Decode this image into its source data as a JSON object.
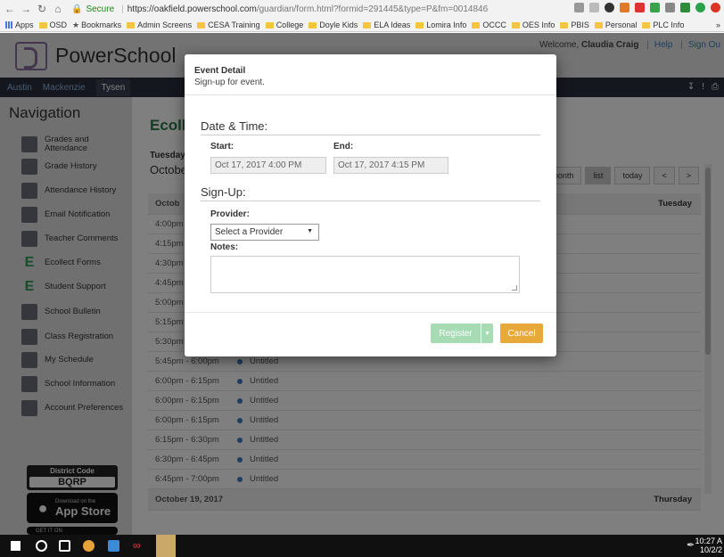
{
  "browser": {
    "secure_label": "Secure",
    "url_host": "https://oakfield.powerschool.com",
    "url_path": "/guardian/form.html?formid=291445&type=P&fm=0014846",
    "bookmarks": [
      "Apps",
      "OSD",
      "Bookmarks",
      "Admin Screens",
      "CESA Training",
      "College",
      "Doyle Kids",
      "ELA Ideas",
      "Lomira Info",
      "OCCC",
      "OES Info",
      "PBIS",
      "Personal",
      "PLC Info"
    ],
    "more": "»"
  },
  "header": {
    "brand": "PowerSchool",
    "welcome_prefix": "Welcome, ",
    "user": "Claudia Craig",
    "help": "Help",
    "sign_out": "Sign Ou"
  },
  "students": [
    "Austin",
    "Mackenzie",
    "Tysen"
  ],
  "navigation": {
    "title": "Navigation",
    "items": [
      "Grades and Attendance",
      "Grade History",
      "Attendance History",
      "Email Notification",
      "Teacher Comments",
      "Ecollect Forms",
      "Student Support",
      "School Bulletin",
      "Class Registration",
      "My Schedule",
      "School Information",
      "Account Preferences"
    ],
    "district_caption": "District Code",
    "district_code": "BQRP",
    "appstore_small": "Download on the",
    "appstore_large": "App Store",
    "getiton": "GET IT ON"
  },
  "main": {
    "ecollect": "Ecolle",
    "day": "Tuesday",
    "month": "Octobe",
    "controls": [
      "month",
      "list",
      "today",
      "<",
      ">"
    ],
    "list_header": {
      "date": "Octob",
      "weekday": "Tuesday"
    },
    "rows": [
      {
        "time": "4:00pm",
        "event": ""
      },
      {
        "time": "4:15pm",
        "event": ""
      },
      {
        "time": "4:30pm",
        "event": ""
      },
      {
        "time": "4:45pm",
        "event": ""
      },
      {
        "time": "5:00pm",
        "event": ""
      },
      {
        "time": "5:15pm",
        "event": ""
      },
      {
        "time": "5:30pm",
        "event": ""
      },
      {
        "time": "5:45pm - 6:00pm",
        "event": "Untitled"
      },
      {
        "time": "6:00pm - 6:15pm",
        "event": "Untitled"
      },
      {
        "time": "6:00pm - 6:15pm",
        "event": "Untitled"
      },
      {
        "time": "6:00pm - 6:15pm",
        "event": "Untitled"
      },
      {
        "time": "6:15pm - 6:30pm",
        "event": "Untitled"
      },
      {
        "time": "6:30pm - 6:45pm",
        "event": "Untitled"
      },
      {
        "time": "6:45pm - 7:00pm",
        "event": "Untitled"
      }
    ],
    "footer_header": {
      "date": "October 19, 2017",
      "weekday": "Thursday"
    }
  },
  "modal": {
    "title": "Event Detail",
    "subtitle": "Sign-up for event.",
    "section_datetime": "Date & Time:",
    "start_label": "Start:",
    "start_value": "Oct 17, 2017 4:00 PM",
    "end_label": "End:",
    "end_value": "Oct 17, 2017 4:15 PM",
    "section_signup": "Sign-Up:",
    "provider_label": "Provider:",
    "provider_selected": "Select a Provider",
    "notes_label": "Notes:",
    "register": "Register",
    "cancel": "Cancel"
  },
  "taskbar": {
    "time": "10:27 A",
    "date": "10/2/2"
  },
  "colors": {
    "register": "#a6dbb3",
    "cancel": "#e6a93a",
    "nav_dark": "#2a2f3e",
    "ecollect_green": "#2a7a4a"
  }
}
